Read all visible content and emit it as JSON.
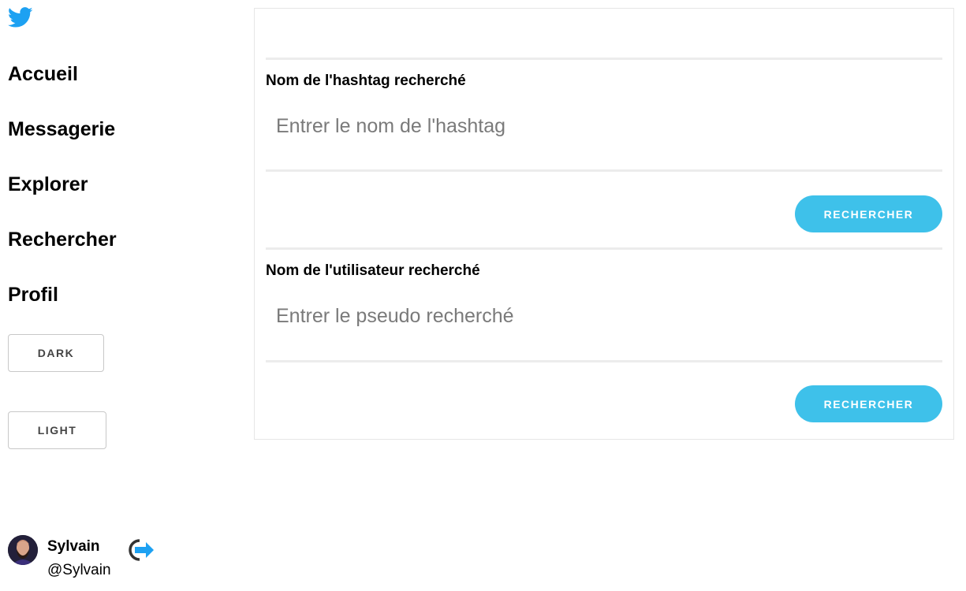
{
  "colors": {
    "accent": "#3ec1ea",
    "twitter_blue": "#1da1f2"
  },
  "sidebar": {
    "logo_icon": "twitter-bird-icon",
    "nav": [
      {
        "label": "Accueil"
      },
      {
        "label": "Messagerie"
      },
      {
        "label": "Explorer"
      },
      {
        "label": "Rechercher"
      },
      {
        "label": "Profil"
      }
    ],
    "theme_buttons": {
      "dark": "DARK",
      "light": "LIGHT"
    },
    "user": {
      "name": "Sylvain",
      "handle": "@Sylvain",
      "logout_icon": "logout-arrow-icon"
    }
  },
  "search": {
    "hashtag": {
      "label": "Nom de l'hashtag recherché",
      "placeholder": "Entrer le nom de l'hashtag",
      "value": "",
      "button": "RECHERCHER"
    },
    "user": {
      "label": "Nom de l'utilisateur recherché",
      "placeholder": "Entrer le pseudo recherché",
      "value": "",
      "button": "RECHERCHER"
    }
  }
}
